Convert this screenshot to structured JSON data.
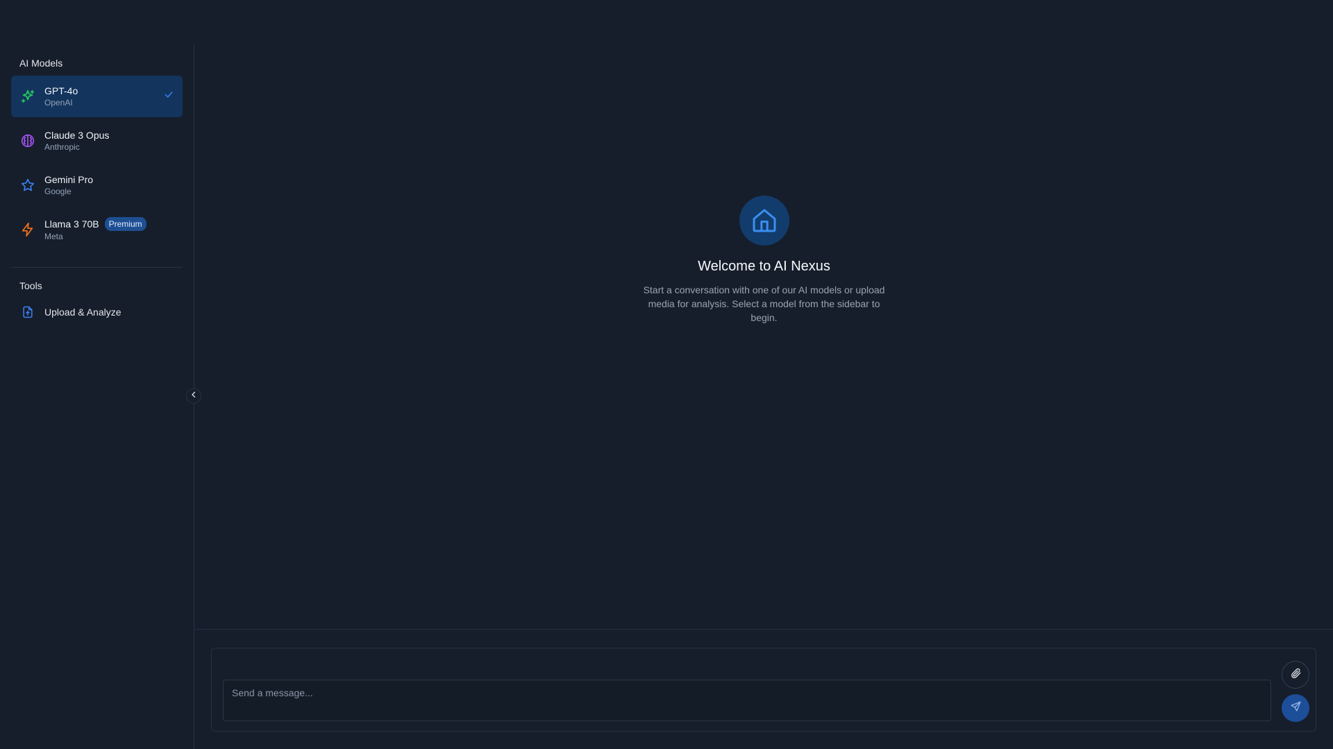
{
  "sidebar": {
    "models_title": "AI Models",
    "models": [
      {
        "name": "GPT-4o",
        "vendor": "OpenAI",
        "icon": "sparkle-icon",
        "color": "#22c55e",
        "active": true
      },
      {
        "name": "Claude 3 Opus",
        "vendor": "Anthropic",
        "icon": "brain-icon",
        "color": "#a855f7",
        "active": false
      },
      {
        "name": "Gemini Pro",
        "vendor": "Google",
        "icon": "star-icon",
        "color": "#3b82f6",
        "active": false
      },
      {
        "name": "Llama 3 70B",
        "vendor": "Meta",
        "icon": "lightning-icon",
        "color": "#f97316",
        "active": false,
        "badge": "Premium"
      }
    ],
    "tools_title": "Tools",
    "tools": [
      {
        "label": "Upload & Analyze",
        "icon": "file-upload-icon",
        "color": "#3b82f6"
      }
    ]
  },
  "welcome": {
    "icon": "home-icon",
    "title": "Welcome to AI Nexus",
    "description": "Start a conversation with one of our AI models or upload media for analysis. Select a model from the sidebar to begin."
  },
  "composer": {
    "placeholder": "Send a message...",
    "value": ""
  },
  "colors": {
    "background": "#161e2b",
    "accent": "#1d4e99",
    "active_item": "#13345d",
    "check": "#3b82f6"
  }
}
